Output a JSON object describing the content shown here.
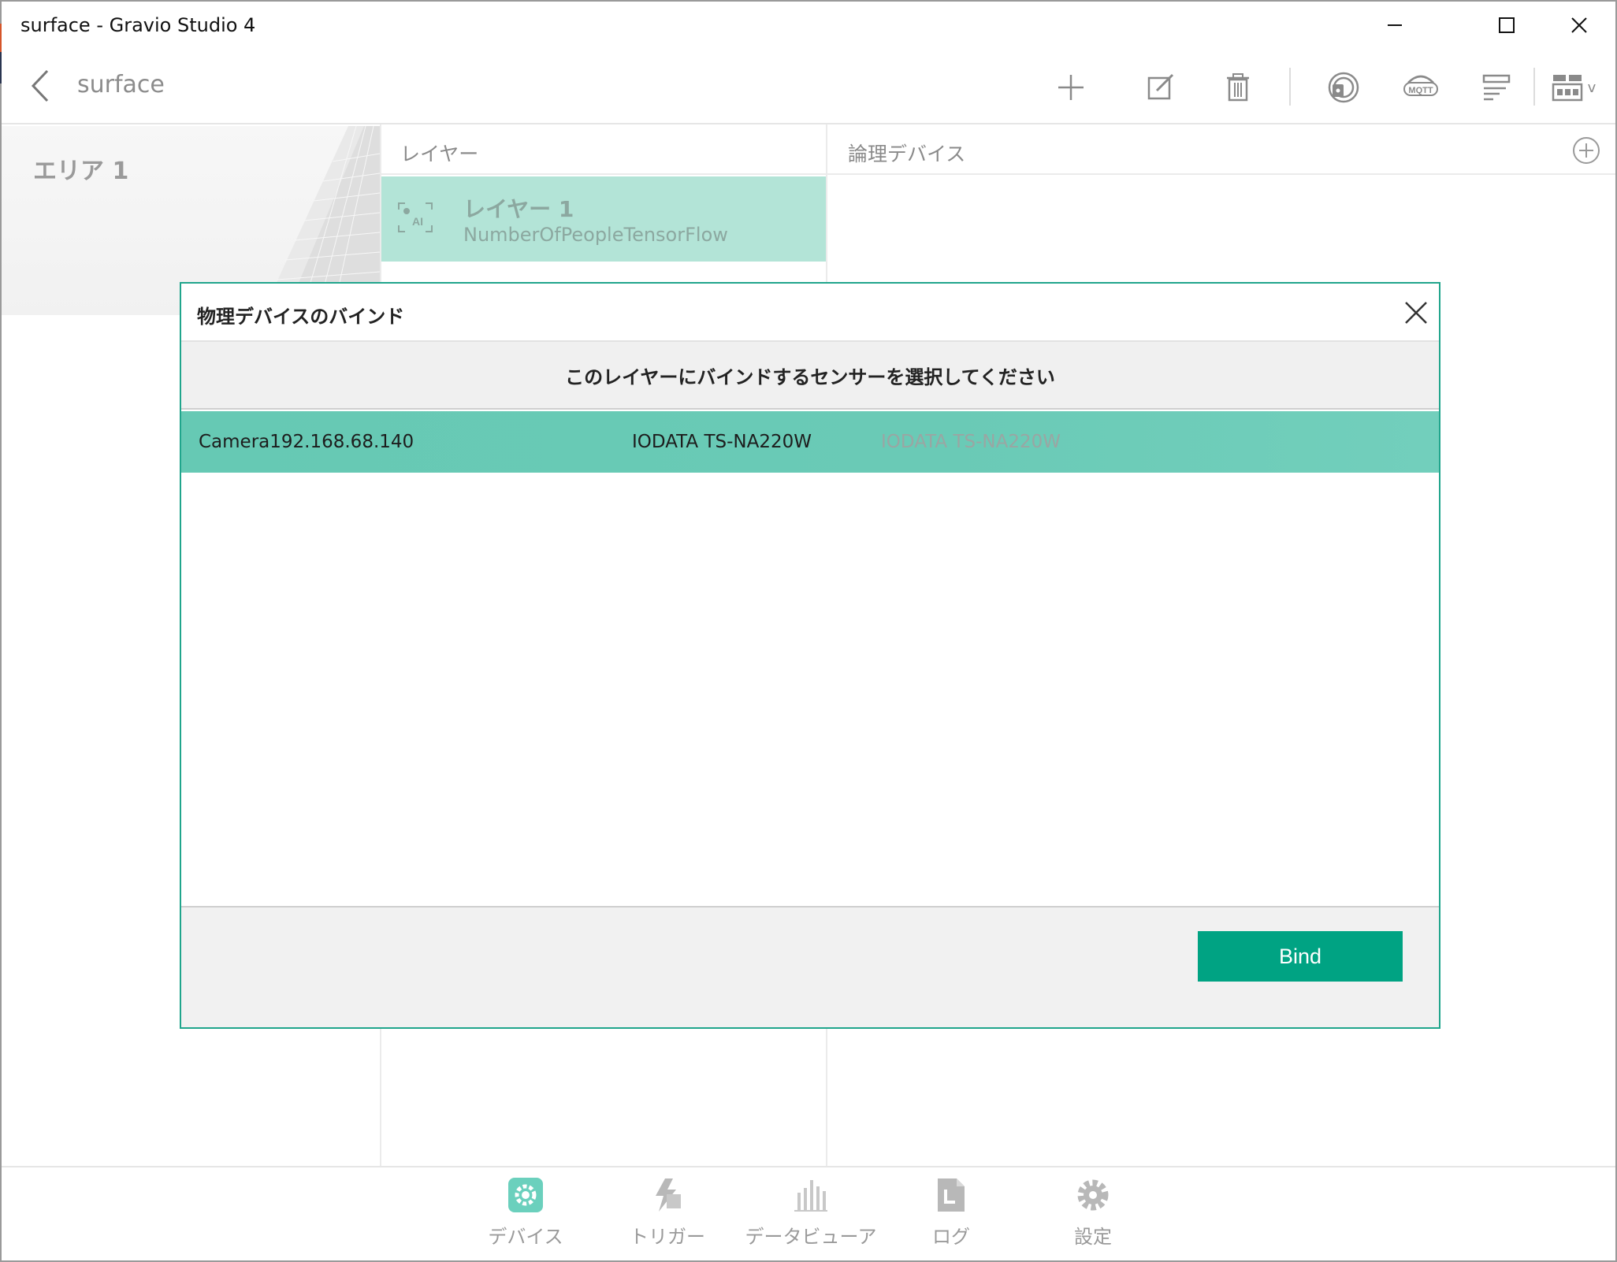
{
  "window": {
    "title": "surface - Gravio Studio 4",
    "controls": [
      "minimize-icon",
      "maximize-icon",
      "close-icon"
    ]
  },
  "topbar": {
    "page_title": "surface",
    "actions": [
      "plus-icon",
      "edit-icon",
      "trash-icon",
      "fingerprint-icon",
      "mqtt-icon",
      "list-icon",
      "grid-view-icon"
    ],
    "mqtt_label": "MQTT",
    "view_chevron": "v"
  },
  "area": {
    "label": "エリア 1"
  },
  "layers": {
    "header": "レイヤー",
    "items": [
      {
        "name": "レイヤー 1",
        "type": "NumberOfPeopleTensorFlow",
        "icon": "ai-camera-icon",
        "icon_text": "AI"
      }
    ]
  },
  "logical_devices": {
    "header": "論理デバイス"
  },
  "dialog": {
    "title": "物理デバイスのバインド",
    "instruction": "このレイヤーにバインドするセンサーを選択してください",
    "devices": [
      {
        "name": "Camera192.168.68.140",
        "model": "IODATA TS-NA220W",
        "type": "IODATA TS-NA220W",
        "selected": true
      }
    ],
    "bind_label": "Bind"
  },
  "bottom_nav": [
    {
      "label": "デバイス",
      "icon": "gear-device-icon",
      "active": true
    },
    {
      "label": "トリガー",
      "icon": "trigger-icon",
      "active": false
    },
    {
      "label": "データビューア",
      "icon": "bar-chart-icon",
      "active": false
    },
    {
      "label": "ログ",
      "icon": "log-icon",
      "active": false
    },
    {
      "label": "設定",
      "icon": "settings-gear-icon",
      "active": false
    }
  ],
  "colors": {
    "accent": "#00a383",
    "dialog_border": "#20a58c",
    "selected_row": "#6acab6",
    "layer_selected": "#b3e4d7",
    "nav_active": "#6bd0bd",
    "nav_inactive": "#b8b8b8"
  }
}
